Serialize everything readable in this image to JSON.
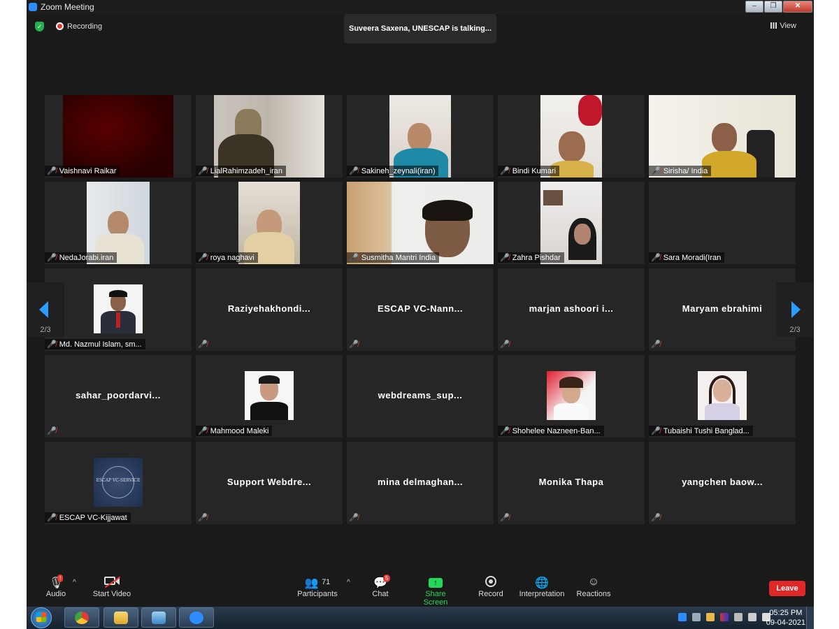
{
  "window": {
    "title": "Zoom Meeting"
  },
  "top": {
    "recording_label": "Recording",
    "talking": "Suveera Saxena, UNESCAP is talking...",
    "view_label": "View"
  },
  "participants": [
    "Vaishnavi Raikar",
    "LialRahimzadeh_iran",
    "Sakineh_zeynali(iran)",
    "Bindi Kumari",
    "Sirisha/ India",
    "NedaJorabi.iran",
    "roya naghavi",
    "Susmitha Mantri India",
    "Zahra Pishdar",
    "Sara Moradi(Iran",
    "Md. Nazmul Islam, sm...",
    "Raziyehakhondi...",
    "ESCAP  VC-Nann...",
    "marjan  ashoori  i...",
    "Maryam  ebrahimi",
    "sahar_poordarvi...",
    "Mahmood Maleki",
    "webdreams_sup...",
    "Shohelee Nazneen-Ban...",
    "Tubaishi Tushi Banglad...",
    "ESCAP VC-Kijjawat",
    "Support  Webdre...",
    "mina  delmaghan...",
    "Monika  Thapa",
    "yangchen  baow..."
  ],
  "escap_logo_text": "ESCAP VC-SERVICE",
  "pagination": {
    "left": "2/3",
    "right": "2/3"
  },
  "toolbar": {
    "audio": "Audio",
    "start_video": "Start Video",
    "participants": "Participants",
    "participants_count": "71",
    "chat": "Chat",
    "chat_badge": "5",
    "share_screen": "Share Screen",
    "record": "Record",
    "interpretation": "Interpretation",
    "reactions": "Reactions",
    "leave": "Leave",
    "audio_badge": "!"
  },
  "taskbar": {
    "time": "05:25 PM",
    "date": "09-04-2021"
  },
  "colors": {
    "accent_green": "#23d959",
    "leave_red": "#e02828",
    "mute_red": "#e53935",
    "arrow_blue": "#2d9cff"
  }
}
